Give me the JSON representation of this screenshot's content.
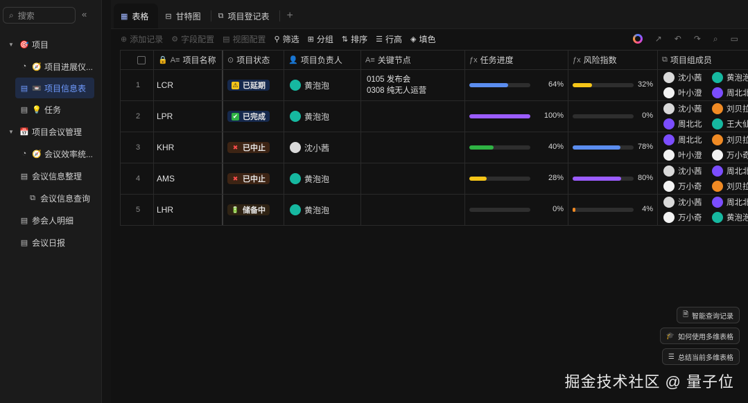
{
  "sidebar": {
    "search_placeholder": "搜索",
    "items": [
      {
        "label": "项目",
        "icon": "🎯"
      },
      {
        "label": "项目进展仪...",
        "icon": "🧭"
      },
      {
        "label": "项目信息表",
        "icon": "📼"
      },
      {
        "label": "任务",
        "icon": "💡"
      },
      {
        "label": "项目会议管理",
        "icon": "📅"
      },
      {
        "label": "会议效率统...",
        "icon": "🧭"
      },
      {
        "label": "会议信息整理"
      },
      {
        "label": "会议信息查询"
      },
      {
        "label": "参会人明细"
      },
      {
        "label": "会议日报"
      }
    ]
  },
  "tabs": [
    {
      "label": "表格"
    },
    {
      "label": "甘特图"
    },
    {
      "label": "项目登记表"
    }
  ],
  "toolbar": {
    "add_record": "添加记录",
    "field_config": "字段配置",
    "view_config": "视图配置",
    "filter": "筛选",
    "group": "分组",
    "sort": "排序",
    "row_height": "行高",
    "fill_color": "填色"
  },
  "table": {
    "headers": {
      "name": "项目名称",
      "status": "项目状态",
      "owner": "项目负责人",
      "milestones": "关键节点",
      "progress": "任务进度",
      "risk": "风险指数",
      "members": "项目组成员"
    },
    "rows": [
      {
        "num": "1",
        "name": "LCR",
        "status": {
          "label": "已延期",
          "icon": "⚠"
        },
        "owner": {
          "name": "黄泡泡",
          "avatar": "teal"
        },
        "milestones": "0105 发布会\n0308 纯无人运营",
        "progress": {
          "value": 0.64,
          "label": "64%",
          "color": "#5b8def"
        },
        "risk": {
          "value": 0.32,
          "label": "32%",
          "color": "#f5c518"
        },
        "members": [
          {
            "name": "沈小茜",
            "avatar": "gray"
          },
          {
            "name": "黄泡泡",
            "avatar": "teal"
          },
          {
            "name": "叶小澄",
            "avatar": "white"
          },
          {
            "name": "周北北",
            "avatar": "purple"
          }
        ]
      },
      {
        "num": "2",
        "name": "LPR",
        "status": {
          "label": "已完成",
          "icon": "✔"
        },
        "owner": {
          "name": "黄泡泡",
          "avatar": "teal"
        },
        "milestones": "",
        "progress": {
          "value": 1.0,
          "label": "100%",
          "color": "#9b5cff"
        },
        "risk": {
          "value": 0.0,
          "label": "0%",
          "color": "#5b8def"
        },
        "members": [
          {
            "name": "沈小茜",
            "avatar": "gray"
          },
          {
            "name": "刘贝拉",
            "avatar": "orange"
          },
          {
            "name": "周北北",
            "avatar": "purple"
          },
          {
            "name": "王大仙",
            "avatar": "teal"
          }
        ]
      },
      {
        "num": "3",
        "name": "KHR",
        "status": {
          "label": "已中止",
          "icon": "✖"
        },
        "owner": {
          "name": "沈小茜",
          "avatar": "gray"
        },
        "milestones": "",
        "progress": {
          "value": 0.4,
          "label": "40%",
          "color": "#2fb344"
        },
        "risk": {
          "value": 0.78,
          "label": "78%",
          "color": "#5b8def"
        },
        "members": [
          {
            "name": "周北北",
            "avatar": "purple"
          },
          {
            "name": "刘贝拉",
            "avatar": "orange"
          },
          {
            "name": "叶小澄",
            "avatar": "white"
          },
          {
            "name": "万小奇",
            "avatar": "white"
          }
        ]
      },
      {
        "num": "4",
        "name": "AMS",
        "status": {
          "label": "已中止",
          "icon": "✖"
        },
        "owner": {
          "name": "黄泡泡",
          "avatar": "teal"
        },
        "milestones": "",
        "progress": {
          "value": 0.28,
          "label": "28%",
          "color": "#f5c518"
        },
        "risk": {
          "value": 0.8,
          "label": "80%",
          "color": "#9b5cff"
        },
        "members": [
          {
            "name": "沈小茜",
            "avatar": "gray"
          },
          {
            "name": "周北北",
            "avatar": "purple"
          },
          {
            "name": "万小奇",
            "avatar": "white"
          },
          {
            "name": "刘贝拉",
            "avatar": "orange"
          }
        ]
      },
      {
        "num": "5",
        "name": "LHR",
        "status": {
          "label": "储备中",
          "icon": "🔋"
        },
        "owner": {
          "name": "黄泡泡",
          "avatar": "teal"
        },
        "milestones": "",
        "progress": {
          "value": 0.0,
          "label": "0%",
          "color": "#5b8def"
        },
        "risk": {
          "value": 0.04,
          "label": "4%",
          "color": "#f08a24"
        },
        "members": [
          {
            "name": "沈小茜",
            "avatar": "gray"
          },
          {
            "name": "周北北",
            "avatar": "purple"
          },
          {
            "name": "万小奇",
            "avatar": "white"
          },
          {
            "name": "黄泡泡",
            "avatar": "teal"
          }
        ]
      }
    ]
  },
  "helpers": {
    "smart_query": "智能查询记录",
    "how_to_use": "如何使用多维表格",
    "summarize": "总结当前多维表格"
  },
  "watermark": "掘金技术社区 @ 量子位"
}
